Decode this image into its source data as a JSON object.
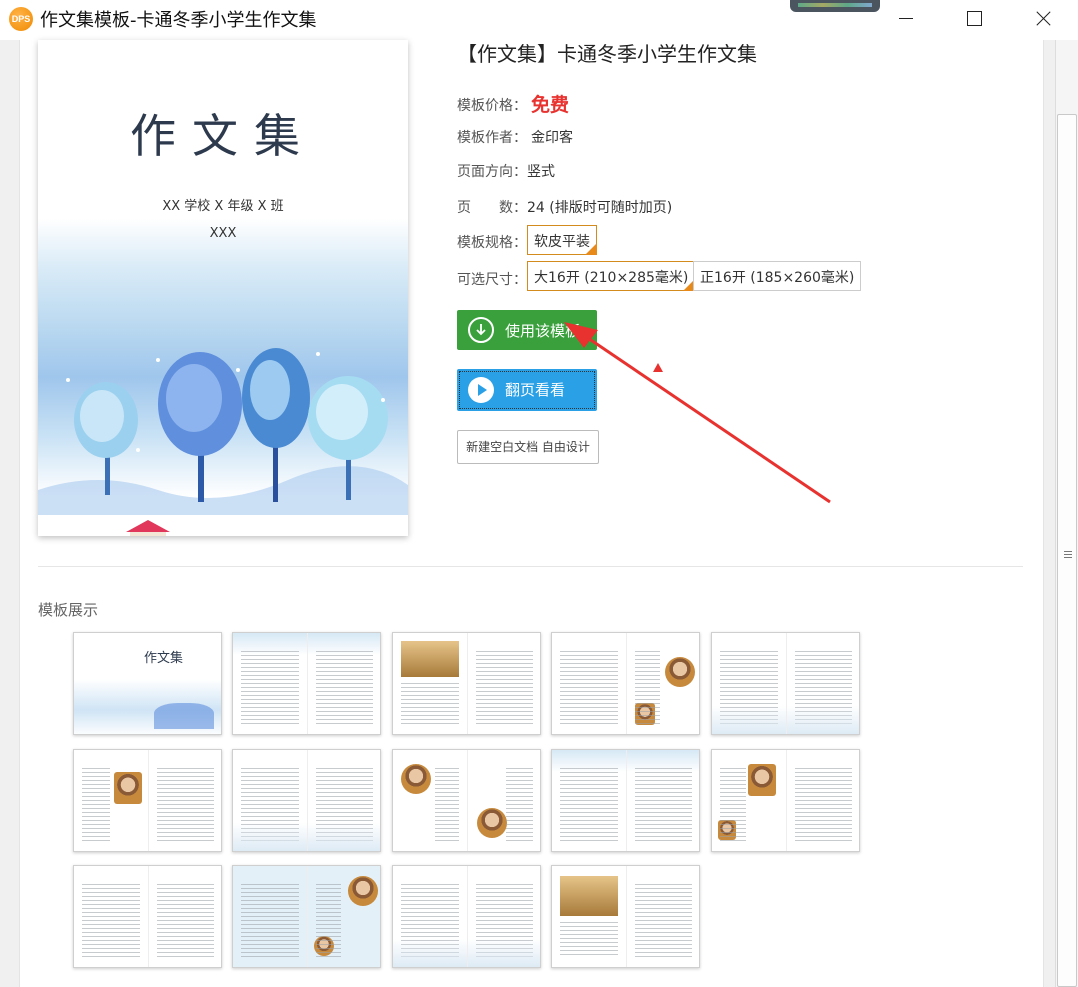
{
  "window": {
    "app_icon_text": "DPS",
    "title": "作文集模板-卡通冬季小学生作文集"
  },
  "cover": {
    "title": "作文集",
    "school_line": "XX 学校 X 年级 X 班",
    "name_line": "XXX"
  },
  "info": {
    "title": "【作文集】卡通冬季小学生作文集",
    "price_label": "模板价格：",
    "price_value": "免费",
    "author_label": "模板作者：",
    "author_value": "金印客",
    "orientation_label": "页面方向：",
    "orientation_value": "竖式",
    "pages_label": "页　　数：",
    "pages_value": "24 (排版时可随时加页)",
    "spec_label": "模板规格：",
    "spec_option": "软皮平装",
    "size_label": "可选尺寸：",
    "size_options": [
      "大16开 (210×285毫米)",
      "正16开 (185×260毫米)"
    ],
    "selected_size_index": 0
  },
  "buttons": {
    "use_template": "使用该模板",
    "flip_view": "翻页看看",
    "new_blank": "新建空白文档 自由设计"
  },
  "colors": {
    "use_button": "#3aa03c",
    "flip_button": "#2aa0e6",
    "price": "#e8322f",
    "selected_border": "#d38b1e",
    "annotation_arrow": "#e8322f"
  },
  "showcase": {
    "title": "模板展示",
    "mini_cover_title": "作文集",
    "thumb_count": 14
  }
}
